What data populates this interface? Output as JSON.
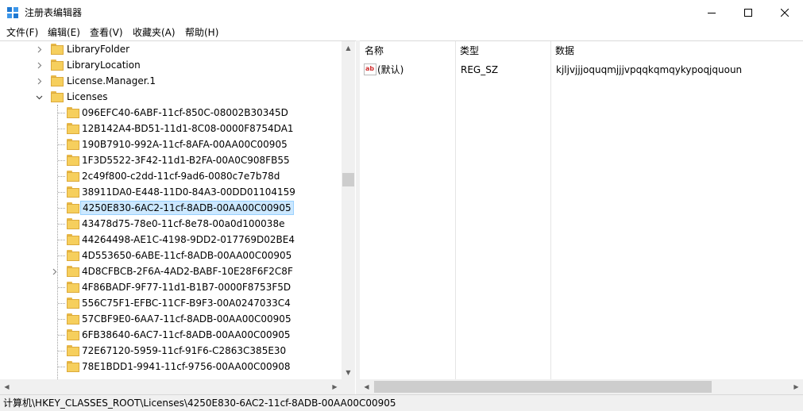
{
  "window": {
    "title": "注册表编辑器",
    "icon": "regedit-icon",
    "controls": {
      "minimize": "—",
      "maximize": "☐",
      "close": "✕"
    }
  },
  "menu": [
    "文件(F)",
    "编辑(E)",
    "查看(V)",
    "收藏夹(A)",
    "帮助(H)"
  ],
  "tree": {
    "items": [
      {
        "label": "LibraryFolder",
        "expander": "›"
      },
      {
        "label": "LibraryLocation",
        "expander": "›"
      },
      {
        "label": "License.Manager.1",
        "expander": "›"
      },
      {
        "label": "Licenses",
        "expander": "⌄",
        "expanded": true
      },
      {
        "label": "096EFC40-6ABF-11cf-850C-08002B30345D"
      },
      {
        "label": "12B142A4-BD51-11d1-8C08-0000F8754DA1"
      },
      {
        "label": "190B7910-992A-11cf-8AFA-00AA00C00905"
      },
      {
        "label": "1F3D5522-3F42-11d1-B2FA-00A0C908FB55"
      },
      {
        "label": "2c49f800-c2dd-11cf-9ad6-0080c7e7b78d"
      },
      {
        "label": "38911DA0-E448-11D0-84A3-00DD01104159"
      },
      {
        "label": "4250E830-6AC2-11cf-8ADB-00AA00C00905",
        "selected": true
      },
      {
        "label": "43478d75-78e0-11cf-8e78-00a0d100038e"
      },
      {
        "label": "44264498-AE1C-4198-9DD2-017769D02BE4"
      },
      {
        "label": "4D553650-6ABE-11cf-8ADB-00AA00C00905"
      },
      {
        "label": "4D8CFBCB-2F6A-4AD2-BABF-10E28F6F2C8F",
        "expander": "›"
      },
      {
        "label": "4F86BADF-9F77-11d1-B1B7-0000F8753F5D"
      },
      {
        "label": "556C75F1-EFBC-11CF-B9F3-00A0247033C4"
      },
      {
        "label": "57CBF9E0-6AA7-11cf-8ADB-00AA00C00905"
      },
      {
        "label": "6FB38640-6AC7-11cf-8ADB-00AA00C00905"
      },
      {
        "label": "72E67120-5959-11cf-91F6-C2863C385E30"
      },
      {
        "label": "78E1BDD1-9941-11cf-9756-00AA00C00908"
      }
    ],
    "scroll_up": "▲",
    "scroll_down": "▼",
    "scroll_left": "◀",
    "scroll_right": "▶"
  },
  "list": {
    "columns": {
      "name": "名称",
      "type": "类型",
      "data": "数据"
    },
    "rows": [
      {
        "icon": "string-value-icon",
        "icon_text": "ab",
        "name": "(默认)",
        "type": "REG_SZ",
        "data": "kjljvjjjoquqmjjjvpqqkqmqykypoqjquoun"
      }
    ],
    "scroll_left": "◀",
    "scroll_right": "▶"
  },
  "status": {
    "path": "计算机\\HKEY_CLASSES_ROOT\\Licenses\\4250E830-6AC2-11cf-8ADB-00AA00C00905"
  },
  "colors": {
    "selection_bg": "#cce8ff",
    "selection_border": "#99d1ff",
    "folder": "#f6cf5d"
  }
}
